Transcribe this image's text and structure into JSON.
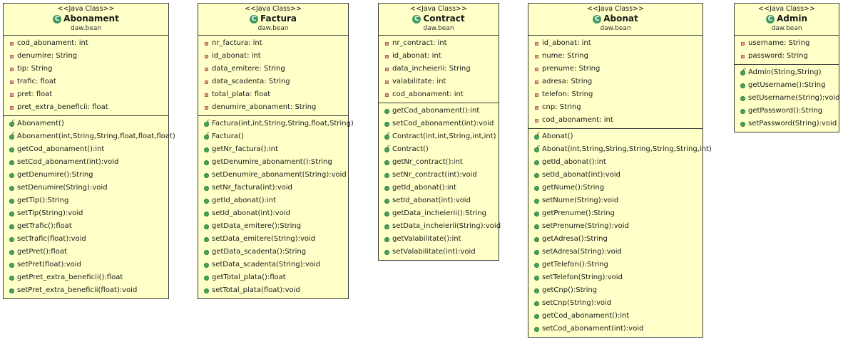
{
  "diagram": {
    "classes": [
      {
        "id": "abonament",
        "stereotype": "<<Java Class>>",
        "icon": "class-icon",
        "name": "Abonament",
        "package": "daw.bean",
        "fields": [
          "cod_abonament: int",
          "denumire: String",
          "tip: String",
          "trafic: float",
          "pret: float",
          "pret_extra_beneficii: float"
        ],
        "constructors": [
          "Abonament()",
          "Abonament(int,String,String,float,float,float)"
        ],
        "methods": [
          "getCod_abonament():int",
          "setCod_abonament(int):void",
          "getDenumire():String",
          "setDenumire(String):void",
          "getTip():String",
          "setTip(String):void",
          "getTrafic():float",
          "setTrafic(float):void",
          "getPret():float",
          "setPret(float):void",
          "getPret_extra_beneficii():float",
          "setPret_extra_beneficii(float):void"
        ]
      },
      {
        "id": "factura",
        "stereotype": "<<Java Class>>",
        "icon": "class-icon",
        "name": "Factura",
        "package": "daw.bean",
        "fields": [
          "nr_factura: int",
          "id_abonat: int",
          "data_emitere: String",
          "data_scadenta: String",
          "total_plata: float",
          "denumire_abonament: String"
        ],
        "constructors": [
          "Factura(int,int,String,String,float,String)",
          "Factura()"
        ],
        "methods": [
          "getNr_factura():int",
          "getDenumire_abonament():String",
          "setDenumire_abonament(String):void",
          "setNr_factura(int):void",
          "getId_abonat():int",
          "setId_abonat(int):void",
          "getData_emitere():String",
          "setData_emitere(String):void",
          "getData_scadenta():String",
          "setData_scadenta(String):void",
          "getTotal_plata():float",
          "setTotal_plata(float):void"
        ]
      },
      {
        "id": "contract",
        "stereotype": "<<Java Class>>",
        "icon": "class-icon",
        "name": "Contract",
        "package": "daw.bean",
        "fields": [
          "nr_contract: int",
          "id_abonat: int",
          "data_incheierii: String",
          "valabilitate: int",
          "cod_abonament: int"
        ],
        "methods_before": [
          "getCod_abonament():int",
          "setCod_abonament(int):void"
        ],
        "constructors": [
          "Contract(int,int,String,int,int)",
          "Contract()"
        ],
        "methods": [
          "getNr_contract():int",
          "setNr_contract(int):void",
          "getId_abonat():int",
          "setId_abonat(int):void",
          "getData_incheierii():String",
          "setData_incheierii(String):void",
          "getValabilitate():int",
          "setValabilitate(int):void"
        ]
      },
      {
        "id": "abonat",
        "stereotype": "<<Java Class>>",
        "icon": "class-icon",
        "name": "Abonat",
        "package": "daw.bean",
        "fields": [
          "id_abonat: int",
          "nume: String",
          "prenume: String",
          "adresa: String",
          "telefon: String",
          "cnp: String",
          "cod_abonament: int"
        ],
        "constructors": [
          "Abonat()",
          "Abonat(int,String,String,String,String,String,int)"
        ],
        "methods": [
          "getId_abonat():int",
          "setId_abonat(int):void",
          "getNume():String",
          "setNume(String):void",
          "getPrenume():String",
          "setPrenume(String):void",
          "getAdresa():String",
          "setAdresa(String):void",
          "getTelefon():String",
          "setTelefon(String):void",
          "getCnp():String",
          "setCnp(String):void",
          "getCod_abonament():int",
          "setCod_abonament(int):void"
        ]
      },
      {
        "id": "admin",
        "stereotype": "<<Java Class>>",
        "icon": "class-icon",
        "name": "Admin",
        "package": "daw.bean",
        "fields": [
          "username: String",
          "password: String"
        ],
        "constructors": [
          "Admin(String,String)"
        ],
        "methods": [
          "getUsername():String",
          "setUsername(String):void",
          "getPassword():String",
          "setPassword(String):void"
        ]
      }
    ]
  }
}
